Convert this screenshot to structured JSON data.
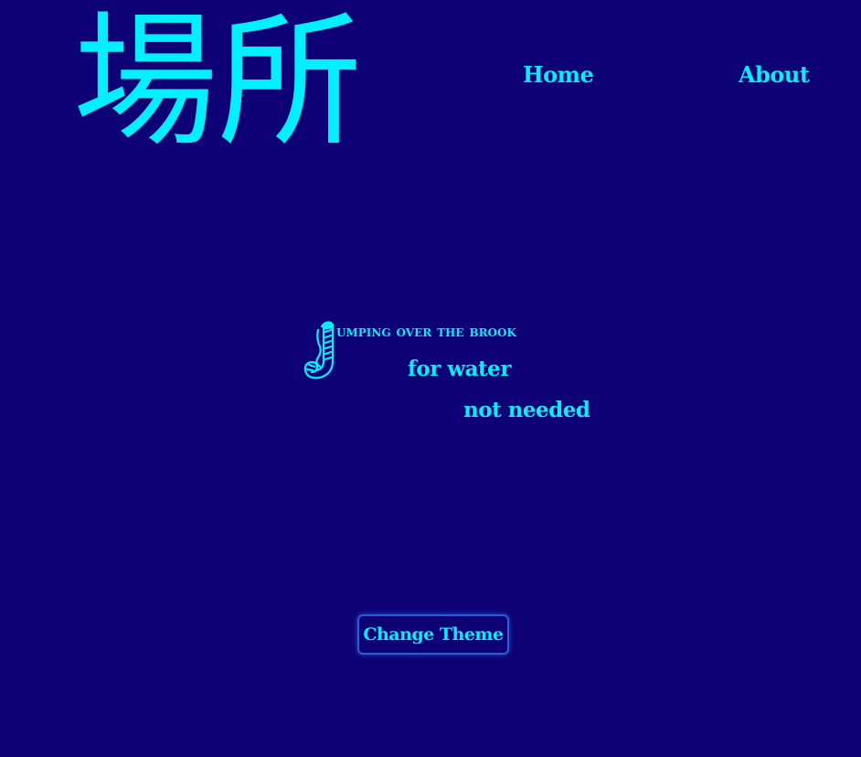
{
  "header": {
    "logo_text": "場所",
    "nav": {
      "home_label": "Home",
      "about_label": "About"
    }
  },
  "poem": {
    "dropcap_letter": "J",
    "line1": "umping over the brook",
    "line2": "for water",
    "line3": "not needed"
  },
  "controls": {
    "change_theme_label": "Change Theme"
  },
  "colors": {
    "background": "#0e0075",
    "accent": "#00f0ff",
    "button_border": "#2a5fd6"
  }
}
